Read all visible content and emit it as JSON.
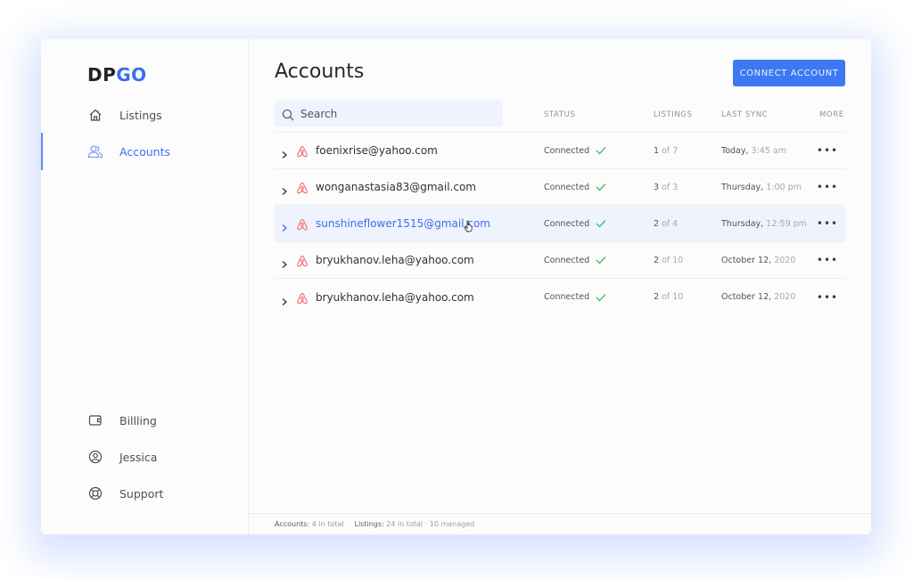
{
  "app": {
    "logo_left": "DP",
    "logo_right": "GO"
  },
  "sidebar": {
    "items": [
      {
        "label": "Listings",
        "icon": "home-icon",
        "active": false
      },
      {
        "label": "Accounts",
        "icon": "users-icon",
        "active": true
      }
    ],
    "bottom_items": [
      {
        "label": "Billling",
        "icon": "wallet-icon"
      },
      {
        "label": "Jessica",
        "icon": "user-circle-icon"
      },
      {
        "label": "Support",
        "icon": "lifebuoy-icon"
      }
    ]
  },
  "header": {
    "title": "Accounts",
    "connect_label": "CONNECT ACCOUNT"
  },
  "search": {
    "placeholder": "Search",
    "value": ""
  },
  "table": {
    "columns": {
      "status": "STATUS",
      "listings": "LISTINGS",
      "last_sync": "LAST SYNC",
      "more": "MORE"
    },
    "rows": [
      {
        "email": "foenixrise@yahoo.com",
        "status": "Connected",
        "listings_count": "1",
        "listings_of": "of 7",
        "sync_day": "Today,",
        "sync_time": "3:45 am",
        "more": "•••",
        "hover": false
      },
      {
        "email": "wonganastasia83@gmail.com",
        "status": "Connected",
        "listings_count": "3",
        "listings_of": "of 3",
        "sync_day": "Thursday,",
        "sync_time": "1:00 pm",
        "more": "•••",
        "hover": false
      },
      {
        "email": "sunshineflower1515@gmail.com",
        "status": "Connected",
        "listings_count": "2",
        "listings_of": "of 4",
        "sync_day": "Thursday,",
        "sync_time": "12:59 pm",
        "more": "•••",
        "hover": true
      },
      {
        "email": "bryukhanov.leha@yahoo.com",
        "status": "Connected",
        "listings_count": "2",
        "listings_of": "of 10",
        "sync_day": "October 12,",
        "sync_time": "2020",
        "more": "•••",
        "hover": false
      },
      {
        "email": "bryukhanov.leha@yahoo.com",
        "status": "Connected",
        "listings_count": "2",
        "listings_of": "of 10",
        "sync_day": "October 12,",
        "sync_time": "2020",
        "more": "•••",
        "hover": false
      }
    ]
  },
  "footer": {
    "accounts_label": "Accounts:",
    "accounts_value": "4 in total",
    "listings_label": "Listings:",
    "listings_value": "24 in total · 10 managed"
  },
  "colors": {
    "accent": "#3c78f2",
    "airbnb": "#f2666c",
    "success": "#3fc26a",
    "hover_row": "#eff3fd"
  }
}
